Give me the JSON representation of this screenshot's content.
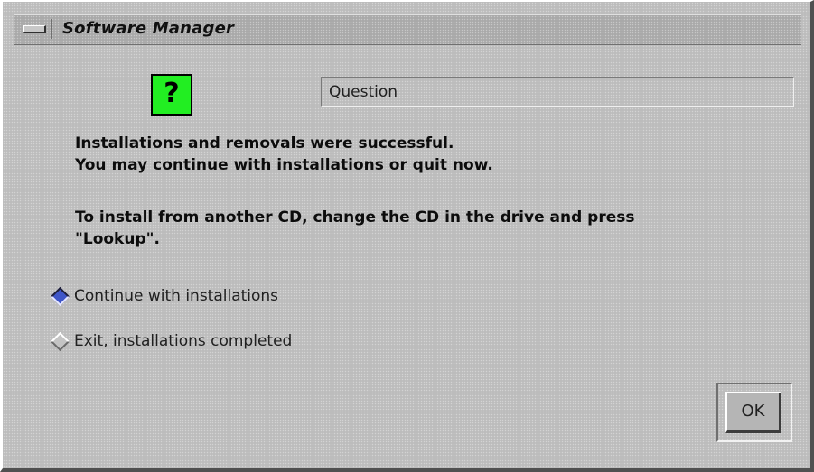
{
  "window": {
    "title": "Software Manager",
    "menu_icon": "window-menu-icon"
  },
  "dialog": {
    "icon_symbol": "?",
    "icon_name": "question-icon",
    "icon_color": "#22ee22",
    "type_label": "Question",
    "message_lines": [
      "Installations and removals were successful.",
      "You may continue with installations or quit now.",
      "To install from another CD, change the CD in the drive and press",
      "\"Lookup\"."
    ],
    "options": [
      {
        "label": "Continue with installations",
        "selected": true
      },
      {
        "label": "Exit, installations completed",
        "selected": false
      }
    ],
    "ok_label": "OK"
  },
  "colors": {
    "background": "#bcbcbc",
    "selected_radio": "#3f56c8"
  }
}
